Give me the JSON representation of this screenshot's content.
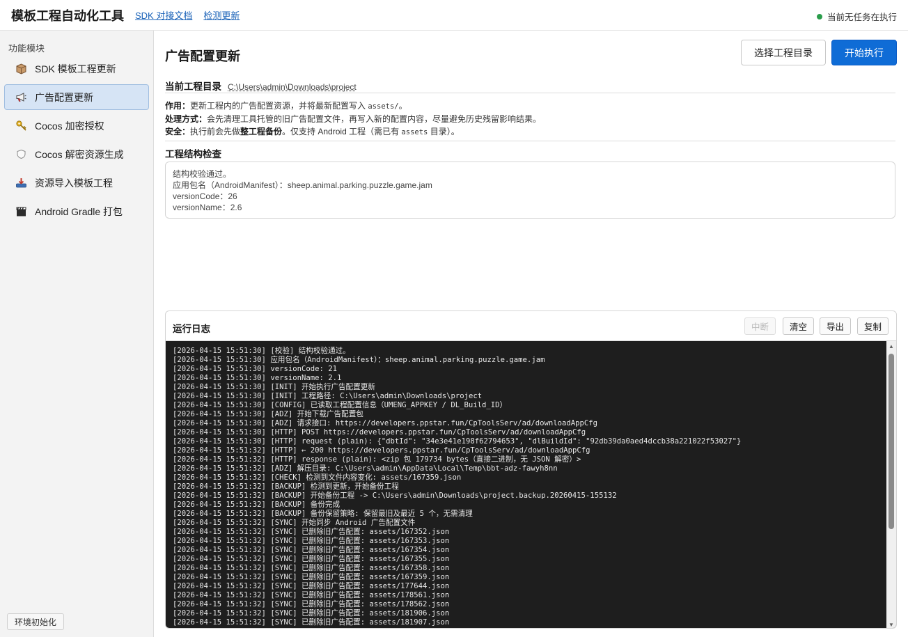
{
  "header": {
    "title": "模板工程自动化工具",
    "links": [
      "SDK 对接文档",
      "检测更新"
    ],
    "status": "当前无任务在执行",
    "status_color": "#2a9d4b"
  },
  "sidebar": {
    "heading": "功能模块",
    "items": [
      {
        "label": "SDK 模板工程更新",
        "icon": "box-icon"
      },
      {
        "label": "广告配置更新",
        "icon": "megaphone-icon"
      },
      {
        "label": "Cocos 加密授权",
        "icon": "key-icon"
      },
      {
        "label": "Cocos 解密资源生成",
        "icon": "shield-icon"
      },
      {
        "label": "资源导入模板工程",
        "icon": "import-icon"
      },
      {
        "label": "Android Gradle 打包",
        "icon": "clapper-icon"
      }
    ],
    "active_index": 1,
    "env_button": "环境初始化"
  },
  "main": {
    "title": "广告配置更新",
    "select_button": "选择工程目录",
    "run_button": "开始执行",
    "accent_color": "#0f6cd6",
    "dir_label": "当前工程目录",
    "dir_value": "C:\\Users\\admin\\Downloads\\project",
    "desc": {
      "l1_label": "作用：",
      "l1_text": "更新工程内的广告配置资源，并将最新配置写入 ",
      "l1_code": "assets/",
      "l1_tail": "。",
      "l2_label": "处理方式：",
      "l2_text": "会先清理工具托管的旧广告配置文件，再写入新的配置内容，尽量避免历史残留影响结果。",
      "l3_label": "安全：",
      "l3_text_a": "执行前会先做",
      "l3_bold": "整工程备份",
      "l3_text_b": "。仅支持 Android 工程（需已有 ",
      "l3_code": "assets",
      "l3_tail": " 目录）。"
    },
    "check_title": "工程结构检查",
    "check_lines": [
      "结构校验通过。",
      "应用包名（AndroidManifest）：sheep.animal.parking.puzzle.game.jam",
      "versionCode：26",
      "versionName：2.6"
    ]
  },
  "log": {
    "title": "运行日志",
    "buttons": {
      "stop": "中断",
      "clear": "清空",
      "export": "导出",
      "copy": "复制"
    },
    "lines": [
      "[2026-04-15 15:51:30] [校验] 结构校验通过。",
      "[2026-04-15 15:51:30] 应用包名（AndroidManifest）：sheep.animal.parking.puzzle.game.jam",
      "[2026-04-15 15:51:30] versionCode: 21",
      "[2026-04-15 15:51:30] versionName: 2.1",
      "[2026-04-15 15:51:30] [INIT] 开始执行广告配置更新",
      "[2026-04-15 15:51:30] [INIT] 工程路径: C:\\Users\\admin\\Downloads\\project",
      "[2026-04-15 15:51:30] [CONFIG] 已读取工程配置信息（UMENG_APPKEY / DL_Build_ID）",
      "[2026-04-15 15:51:30] [ADZ] 开始下载广告配置包",
      "[2026-04-15 15:51:30] [ADZ] 请求接口: https://developers.ppstar.fun/CpToolsServ/ad/downloadAppCfg",
      "[2026-04-15 15:51:30] [HTTP] POST https://developers.ppstar.fun/CpToolsServ/ad/downloadAppCfg",
      "[2026-04-15 15:51:30] [HTTP] request (plain): {\"dbtId\": \"34e3e41e198f62794653\", \"dlBuildId\": \"92db39da0aed4dccb38a221022f53027\"}",
      "[2026-04-15 15:51:32] [HTTP] ← 200 https://developers.ppstar.fun/CpToolsServ/ad/downloadAppCfg",
      "[2026-04-15 15:51:32] [HTTP] response (plain): <zip 包 179734 bytes（直接二进制，无 JSON 解密）>",
      "[2026-04-15 15:51:32] [ADZ] 解压目录: C:\\Users\\admin\\AppData\\Local\\Temp\\bbt-adz-fawyh8nn",
      "[2026-04-15 15:51:32] [CHECK] 检测到文件内容变化: assets/167359.json",
      "[2026-04-15 15:51:32] [BACKUP] 检测到更新，开始备份工程",
      "[2026-04-15 15:51:32] [BACKUP] 开始备份工程 -> C:\\Users\\admin\\Downloads\\project.backup.20260415-155132",
      "[2026-04-15 15:51:32] [BACKUP] 备份完成",
      "[2026-04-15 15:51:32] [BACKUP] 备份保留策略: 保留最旧及最近 5 个，无需清理",
      "[2026-04-15 15:51:32] [SYNC] 开始同步 Android 广告配置文件",
      "[2026-04-15 15:51:32] [SYNC] 已删除旧广告配置: assets/167352.json",
      "[2026-04-15 15:51:32] [SYNC] 已删除旧广告配置: assets/167353.json",
      "[2026-04-15 15:51:32] [SYNC] 已删除旧广告配置: assets/167354.json",
      "[2026-04-15 15:51:32] [SYNC] 已删除旧广告配置: assets/167355.json",
      "[2026-04-15 15:51:32] [SYNC] 已删除旧广告配置: assets/167358.json",
      "[2026-04-15 15:51:32] [SYNC] 已删除旧广告配置: assets/167359.json",
      "[2026-04-15 15:51:32] [SYNC] 已删除旧广告配置: assets/177644.json",
      "[2026-04-15 15:51:32] [SYNC] 已删除旧广告配置: assets/178561.json",
      "[2026-04-15 15:51:32] [SYNC] 已删除旧广告配置: assets/178562.json",
      "[2026-04-15 15:51:32] [SYNC] 已删除旧广告配置: assets/181906.json",
      "[2026-04-15 15:51:32] [SYNC] 已删除旧广告配置: assets/181907.json"
    ]
  }
}
